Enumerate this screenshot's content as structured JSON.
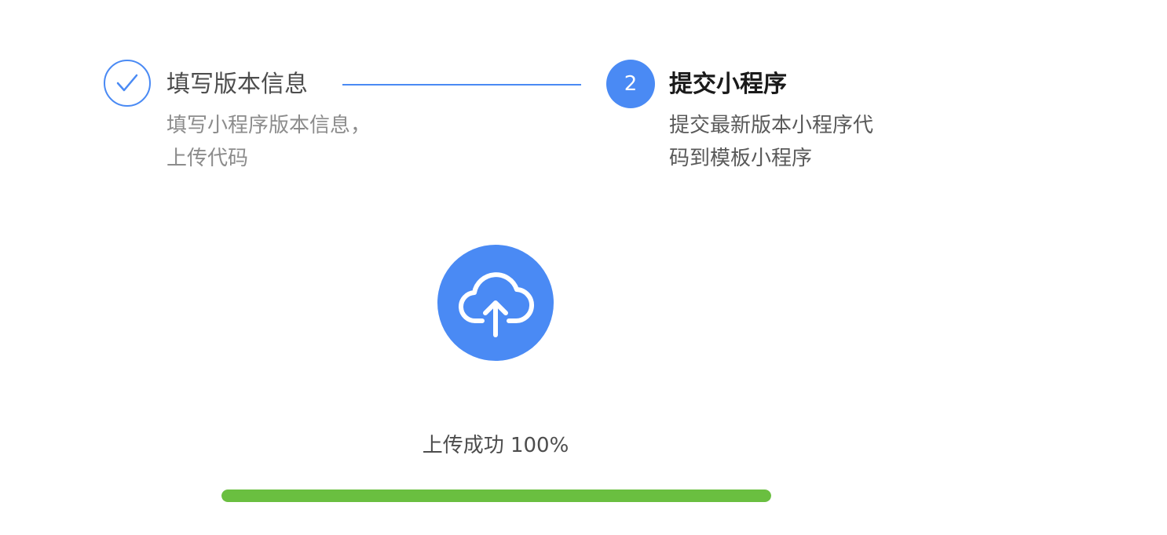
{
  "steps": [
    {
      "state": "done",
      "title": "填写版本信息",
      "description_line1": "填写小程序版本信息，",
      "description_line2": "上传代码",
      "icon": "check-icon"
    },
    {
      "state": "active",
      "number": "2",
      "title": "提交小程序",
      "description_line1": "提交最新版本小程序代",
      "description_line2": "码到模板小程序"
    }
  ],
  "upload": {
    "icon": "cloud-upload-icon",
    "status_text": "上传成功 100%",
    "progress": 1.0
  },
  "colors": {
    "accent": "#4a8af4",
    "success": "#6abf40",
    "text_primary": "#1a1a1a",
    "text_secondary": "#8c8c8c"
  }
}
